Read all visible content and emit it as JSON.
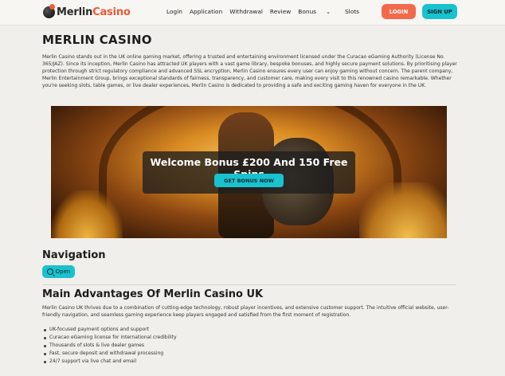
{
  "header": {
    "logo_part1": "Merlin",
    "logo_part2": "Casino",
    "nav": [
      "Login",
      "Application",
      "Withdrawal",
      "Review",
      "Bonus",
      "Slots"
    ],
    "login_label": "LOGIN",
    "signup_label": "SIGN UP"
  },
  "main": {
    "title": "MERLIN CASINO",
    "intro": "Merlin Casino stands out in the UK online gaming market, offering a trusted and entertaining environment licensed under the Curacao eGaming Authority (License No. 365/JAZ). Since its inception, Merlin Casino has attracted UK players with a vast game library, bespoke bonuses, and highly secure payment solutions. By prioritising player protection through strict regulatory compliance and advanced SSL encryption, Merlin Casino ensures every user can enjoy gaming without concern. The parent company, Merlin Entertainment Group, brings exceptional standards of fairness, transparency, and customer care, making every visit to this renowned casino remarkable. Whether you're seeking slots, table games, or live dealer experiences, Merlin Casino is dedicated to providing a safe and exciting gaming haven for everyone in the UK.",
    "banner": {
      "title": "Welcome Bonus £200 And 150 Free Spins",
      "cta": "GET BONUS NOW"
    },
    "navigation_heading": "Navigation",
    "open_label": "Open",
    "advantages_heading": "Main Advantages Of Merlin Casino UK",
    "advantages_text": "Merlin Casino UK thrives due to a combination of cutting-edge technology, robust player incentives, and extensive customer support. The intuitive official website, user-friendly navigation, and seamless gaming experience keep players engaged and satisfied from the first moment of registration.",
    "advantages": [
      "UK-focused payment options and support",
      "Curacao eGaming license for international credibility",
      "Thousands of slots & live dealer games",
      "Fast, secure deposit and withdrawal processing",
      "24/7 support via live chat and email"
    ]
  },
  "colors": {
    "accent_orange": "#f26a4a",
    "accent_teal": "#19c2cf",
    "background": "#f1efeb"
  }
}
